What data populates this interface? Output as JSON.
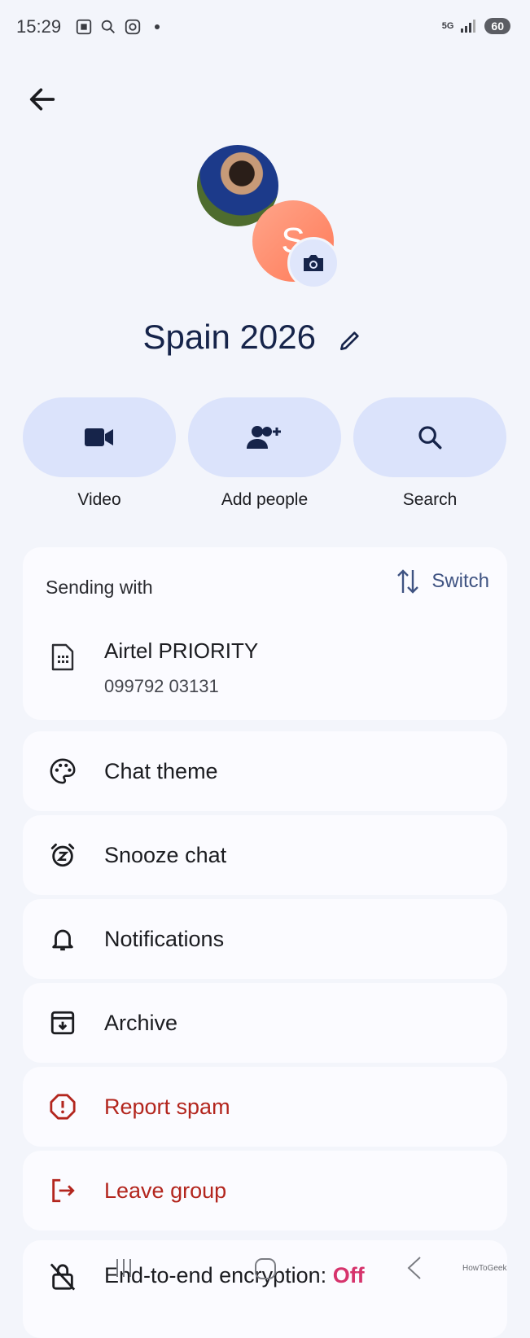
{
  "status_bar": {
    "time": "15:29",
    "network": "5G",
    "battery": "60"
  },
  "header": {
    "group_name": "Spain 2026",
    "avatar_initial": "S"
  },
  "actions": [
    {
      "label": "Video",
      "icon": "video-icon"
    },
    {
      "label": "Add people",
      "icon": "add-people-icon"
    },
    {
      "label": "Search",
      "icon": "search-icon"
    }
  ],
  "sending": {
    "title": "Sending with",
    "switch_label": "Switch",
    "carrier": "Airtel PRIORITY",
    "number": "099792 03131"
  },
  "menu": [
    {
      "label": "Chat theme",
      "icon": "palette-icon"
    },
    {
      "label": "Snooze chat",
      "icon": "snooze-alarm-icon"
    },
    {
      "label": "Notifications",
      "icon": "bell-icon"
    },
    {
      "label": "Archive",
      "icon": "archive-icon"
    },
    {
      "label": "Report spam",
      "icon": "report-icon",
      "danger": true
    },
    {
      "label": "Leave group",
      "icon": "leave-icon",
      "danger": true
    }
  ],
  "encryption": {
    "label": "End-to-end encryption:",
    "status": "Off"
  },
  "watermark": "HowToGeek",
  "colors": {
    "background": "#f3f5fb",
    "card": "#fbfbff",
    "action_bg": "#dbe3fb",
    "danger": "#b3261e",
    "off_status": "#d6336c",
    "title": "#16244a"
  }
}
